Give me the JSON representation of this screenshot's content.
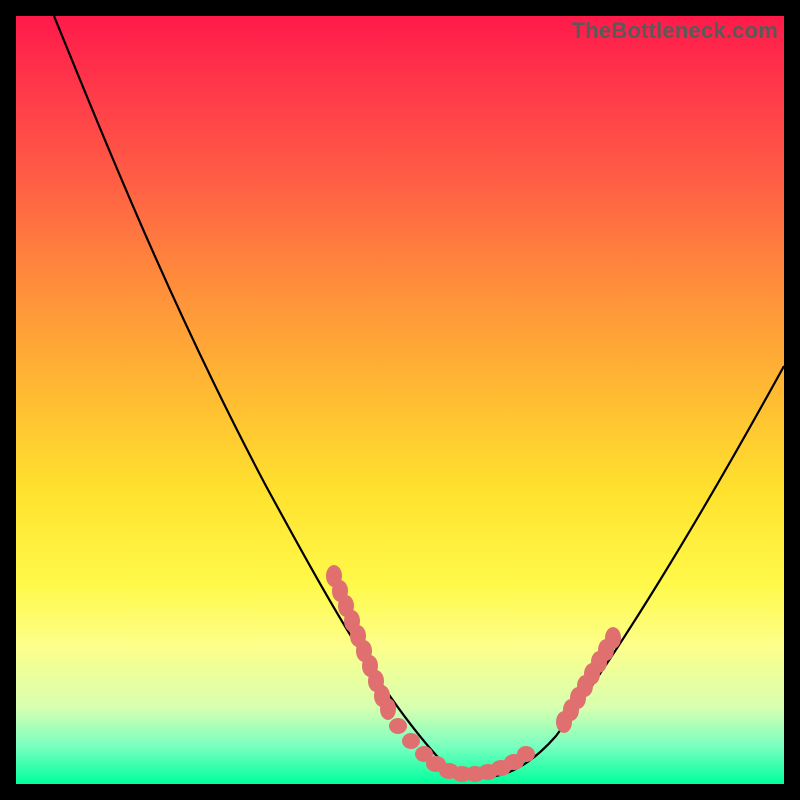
{
  "watermark": "TheBottleneck.com",
  "chart_data": {
    "type": "line",
    "title": "",
    "xlabel": "",
    "ylabel": "",
    "xlim": [
      0,
      100
    ],
    "ylim": [
      0,
      100
    ],
    "series": [
      {
        "name": "curve",
        "x": [
          5,
          10,
          15,
          20,
          25,
          30,
          35,
          40,
          45,
          50,
          52,
          54,
          56,
          58,
          60,
          62,
          65,
          70,
          75,
          80,
          85,
          90,
          95,
          100
        ],
        "y": [
          100,
          92,
          83,
          73,
          63,
          53,
          43,
          33,
          23,
          12,
          8,
          5,
          3,
          1.5,
          0.8,
          0.3,
          0.5,
          3,
          8,
          16,
          26,
          37,
          47,
          56
        ]
      }
    ],
    "markers": {
      "left_cluster": {
        "x_range": [
          41,
          49
        ],
        "y_range": [
          12,
          30
        ],
        "count": 14
      },
      "floor_cluster": {
        "x_range": [
          49,
          66
        ],
        "y_range": [
          0,
          4
        ],
        "count": 20
      },
      "right_cluster": {
        "x_range": [
          71,
          78
        ],
        "y_range": [
          6,
          16
        ],
        "count": 10
      }
    },
    "background": "vertical gradient red→yellow→green",
    "grid": false
  }
}
